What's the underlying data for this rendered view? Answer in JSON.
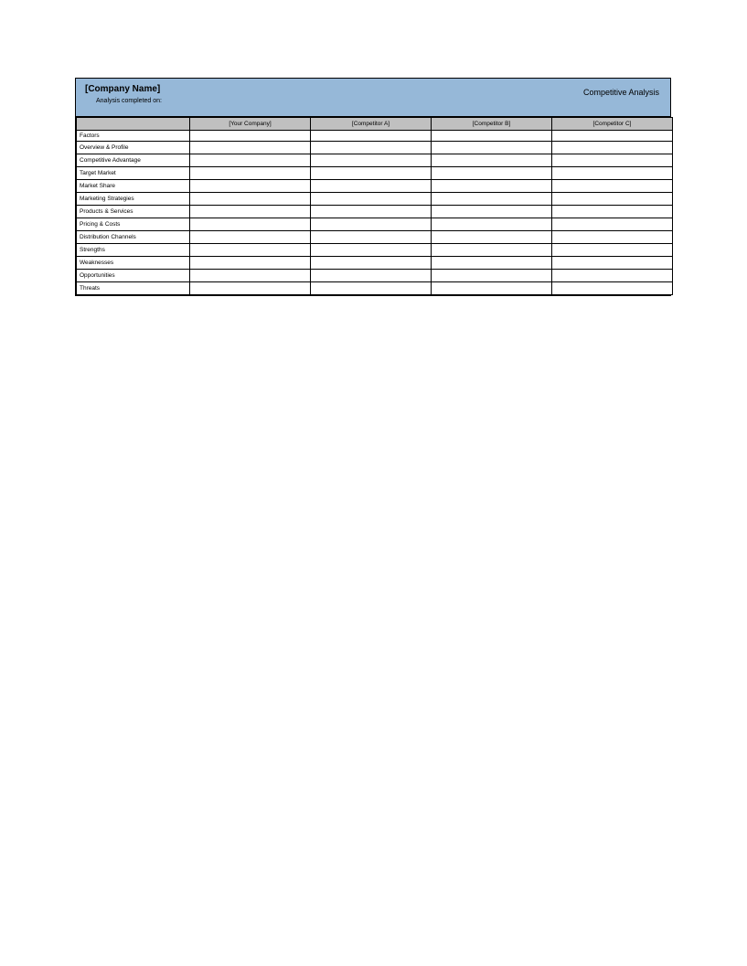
{
  "header": {
    "company_name": "[Company Name]",
    "analysis_date_label": "Analysis completed on:",
    "doc_title": "Competitive Analysis"
  },
  "table": {
    "columns": [
      "",
      "[Your Company]",
      "[Competitor A]",
      "[Competitor B]",
      "[Competitor C]"
    ],
    "rows": [
      {
        "label": "Factors",
        "cells": [
          "",
          "",
          "",
          ""
        ],
        "is_factors": true
      },
      {
        "label": "Overview & Profile",
        "cells": [
          "",
          "",
          "",
          ""
        ]
      },
      {
        "label": "Competitive Advantage",
        "cells": [
          "",
          "",
          "",
          ""
        ]
      },
      {
        "label": "Target Market",
        "cells": [
          "",
          "",
          "",
          ""
        ]
      },
      {
        "label": "Market Share",
        "cells": [
          "",
          "",
          "",
          ""
        ]
      },
      {
        "label": "Marketing Strategies",
        "cells": [
          "",
          "",
          "",
          ""
        ]
      },
      {
        "label": "Products & Services",
        "cells": [
          "",
          "",
          "",
          ""
        ]
      },
      {
        "label": "Pricing & Costs",
        "cells": [
          "",
          "",
          "",
          ""
        ]
      },
      {
        "label": "Distribution Channels",
        "cells": [
          "",
          "",
          "",
          ""
        ]
      },
      {
        "label": "Strengths",
        "cells": [
          "",
          "",
          "",
          ""
        ]
      },
      {
        "label": "Weaknesses",
        "cells": [
          "",
          "",
          "",
          ""
        ]
      },
      {
        "label": "Opportunities",
        "cells": [
          "",
          "",
          "",
          ""
        ]
      },
      {
        "label": "Threats",
        "cells": [
          "",
          "",
          "",
          ""
        ]
      }
    ]
  }
}
